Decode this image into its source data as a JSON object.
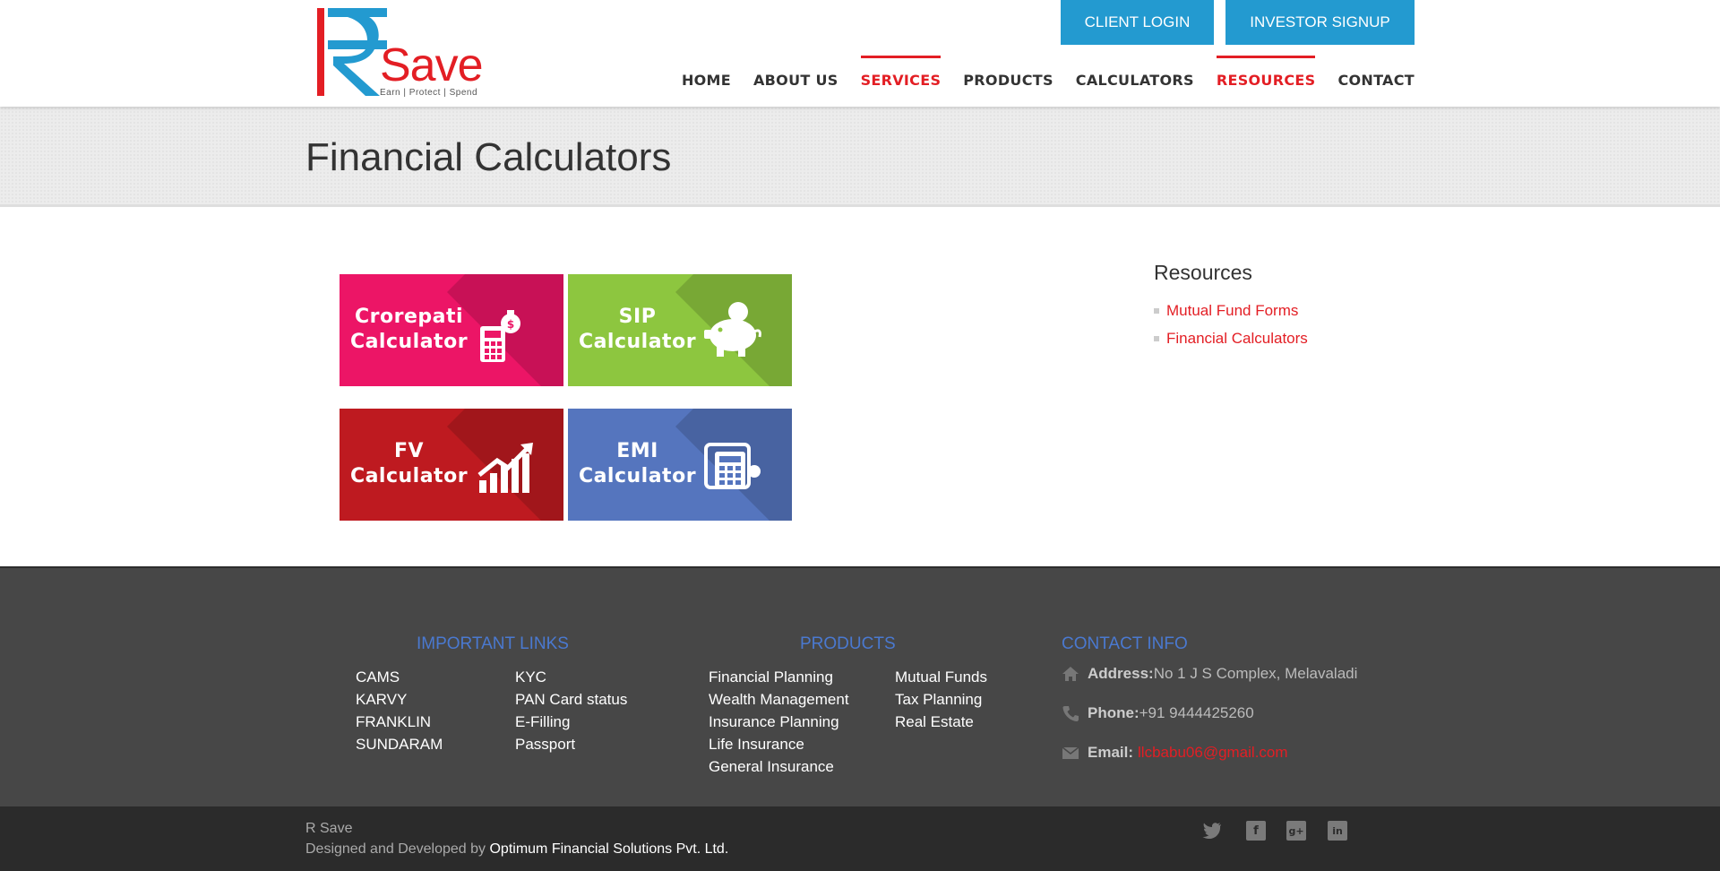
{
  "header": {
    "logo_text": "Save",
    "logo_tagline": "Earn | Protect | Spend",
    "client_login": "CLIENT LOGIN",
    "investor_signup": "INVESTOR SIGNUP",
    "nav": [
      "HOME",
      "ABOUT US",
      "SERVICES",
      "PRODUCTS",
      "CALCULATORS",
      "RESOURCES",
      "CONTACT"
    ],
    "nav_active": [
      "SERVICES",
      "RESOURCES"
    ]
  },
  "page_title": "Financial Calculators",
  "tiles": [
    {
      "line1": "Crorepati",
      "line2": "Calculator",
      "color": "#ec1566",
      "icon": "calculator-money-bag-icon"
    },
    {
      "line1": "SIP",
      "line2": "Calculator",
      "color": "#8dc63f",
      "icon": "piggy-bank-icon"
    },
    {
      "line1": "FV",
      "line2": "Calculator",
      "color": "#be1a20",
      "icon": "growth-chart-icon"
    },
    {
      "line1": "EMI",
      "line2": "Calculator",
      "color": "#5575be",
      "icon": "calculator-card-icon"
    }
  ],
  "sidebar": {
    "title": "Resources",
    "items": [
      "Mutual Fund Forms",
      "Financial Calculators"
    ]
  },
  "footer": {
    "important_links_title": "IMPORTANT LINKS",
    "important_links_col1": [
      "CAMS",
      "KARVY",
      "FRANKLIN",
      "SUNDARAM"
    ],
    "important_links_col2": [
      "KYC",
      "PAN Card status",
      "E-Filling",
      "Passport"
    ],
    "products_title": "PRODUCTS",
    "products_col1": [
      "Financial Planning",
      "Wealth Management",
      "Insurance Planning",
      "Life Insurance",
      "General Insurance"
    ],
    "products_col2": [
      "Mutual Funds",
      "Tax Planning",
      "Real Estate"
    ],
    "contact_title": "CONTACT INFO",
    "address_label": "Address:",
    "address_value": "No 1 J S Complex, Melavaladi",
    "phone_label": "Phone:",
    "phone_value": "+91 9444425260",
    "email_label": "Email:",
    "email_value": "llcbabu06@gmail.com"
  },
  "bottom": {
    "brand": "R Save",
    "designed_by": "Designed and Developed by",
    "company": "Optimum Financial Solutions Pvt. Ltd."
  },
  "colors": {
    "accent_red": "#e31e24",
    "button_blue": "#239ad0",
    "footer_heading": "#4a79d0"
  }
}
